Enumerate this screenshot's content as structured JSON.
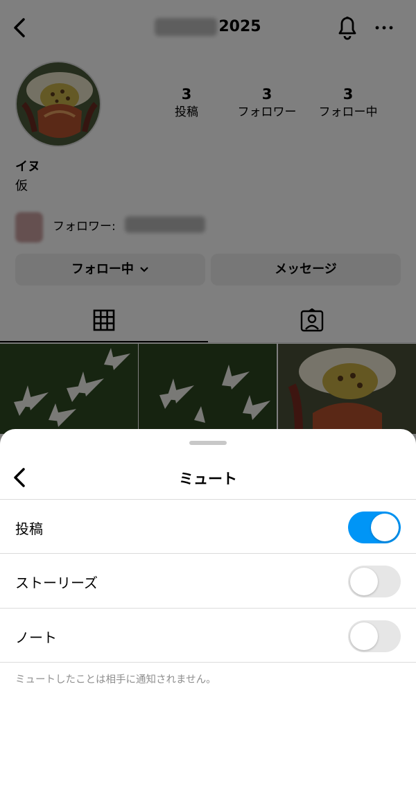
{
  "profile": {
    "username_suffix": "2025",
    "stats": [
      {
        "count": "3",
        "label": "投稿"
      },
      {
        "count": "3",
        "label": "フォロワー"
      },
      {
        "count": "3",
        "label": "フォロー中"
      }
    ],
    "display_name": "イヌ",
    "bio": "仮",
    "followers_prefix": "フォロワー:",
    "follow_button": "フォロー中",
    "message_button": "メッセージ"
  },
  "sheet": {
    "title": "ミュート",
    "rows": [
      {
        "label": "投稿",
        "on": true
      },
      {
        "label": "ストーリーズ",
        "on": false
      },
      {
        "label": "ノート",
        "on": false
      }
    ],
    "footnote": "ミュートしたことは相手に通知されません。"
  },
  "colors": {
    "accent": "#0095f6",
    "toggle_off": "#e6e6e6",
    "note_text": "#8e8e8e"
  }
}
